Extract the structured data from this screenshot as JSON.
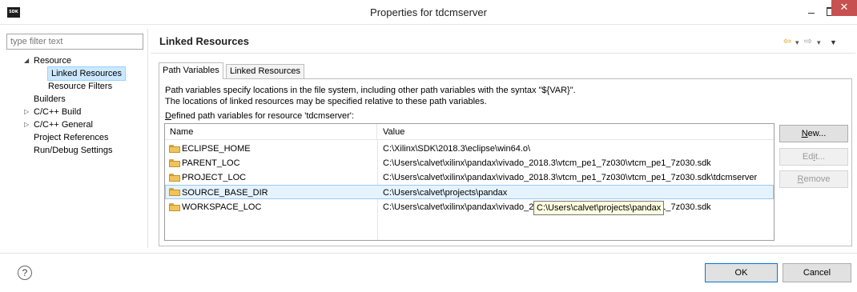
{
  "window": {
    "app_icon_text": "SDK",
    "title": "Properties for tdcmserver",
    "minimize": "–",
    "maximize": "",
    "close": "✕"
  },
  "sidebar": {
    "filter_placeholder": "type filter text",
    "items": [
      {
        "label": "Resource",
        "arrow": "◢"
      },
      {
        "label": "Linked Resources",
        "selected": true
      },
      {
        "label": "Resource Filters"
      },
      {
        "label": "Builders"
      },
      {
        "label": "C/C++ Build",
        "arrow": "▷"
      },
      {
        "label": "C/C++ General",
        "arrow": "▷"
      },
      {
        "label": "Project References"
      },
      {
        "label": "Run/Debug Settings"
      }
    ]
  },
  "page": {
    "title": "Linked Resources",
    "nav": {
      "back": "⇦",
      "dropdown": "▾",
      "forward": "⇨",
      "menu": "▼"
    },
    "tabs": [
      "Path Variables",
      "Linked Resources"
    ],
    "desc_line1": "Path variables specify locations in the file system, including other path variables with the syntax \"${VAR}\".",
    "desc_line2": "The locations of linked resources may be specified relative to these path variables.",
    "defined_prefix": "D",
    "defined_rest": "efined path variables for resource 'tdcmserver':",
    "table": {
      "columns": [
        "Name",
        "Value"
      ],
      "rows": [
        {
          "name": "ECLIPSE_HOME",
          "value": "C:\\Xilinx\\SDK\\2018.3\\eclipse\\win64.o\\"
        },
        {
          "name": "PARENT_LOC",
          "value": "C:\\Users\\calvet\\xilinx\\pandax\\vivado_2018.3\\vtcm_pe1_7z030\\vtcm_pe1_7z030.sdk"
        },
        {
          "name": "PROJECT_LOC",
          "value": "C:\\Users\\calvet\\xilinx\\pandax\\vivado_2018.3\\vtcm_pe1_7z030\\vtcm_pe1_7z030.sdk\\tdcmserver"
        },
        {
          "name": "SOURCE_BASE_DIR",
          "value": "C:\\Users\\calvet\\projects\\pandax",
          "selected": true
        },
        {
          "name": "WORKSPACE_LOC",
          "value": "C:\\Users\\calvet\\xilinx\\pandax\\vivado_2018.3\\vtcm_pe1_7z030\\vtcm_pe1_7z030.sdk"
        }
      ]
    },
    "buttons": {
      "new_u": "N",
      "new_rest": "ew...",
      "edit_pre": "Ed",
      "edit_u": "i",
      "edit_rest": "t...",
      "remove_u": "R",
      "remove_rest": "emove"
    },
    "tooltip": "C:\\Users\\calvet\\projects\\pandax"
  },
  "footer": {
    "help": "?",
    "ok": "OK",
    "cancel": "Cancel"
  }
}
